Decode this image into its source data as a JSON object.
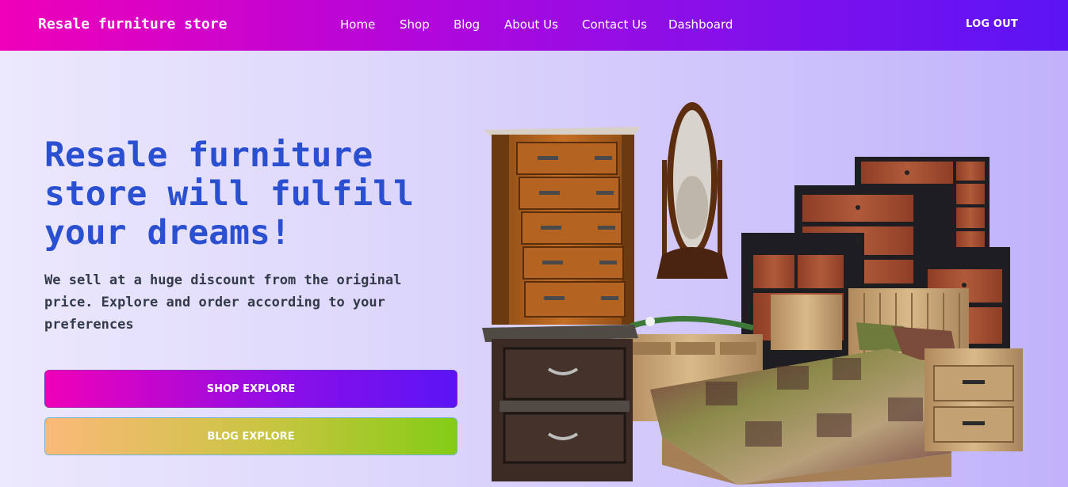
{
  "navbar": {
    "brand": "Resale furniture store",
    "links": [
      "Home",
      "Shop",
      "Blog",
      "About Us",
      "Contact Us",
      "Dashboard"
    ],
    "logout": "LOG OUT"
  },
  "hero": {
    "title_lines": [
      "Resale furniture",
      "store will fulfill",
      "your dreams!"
    ],
    "subtitle_lines": [
      "We sell at a huge discount from the original",
      "price. Explore and order according to your",
      "preferences"
    ],
    "shop_button": "SHOP EXPLORE",
    "blog_button": "BLOG EXPLORE"
  },
  "colors": {
    "primary_pink": "#f000b8",
    "primary_violet": "#5b14f5",
    "title_blue": "#2a4fd0",
    "secondary_orange": "#fbb97a",
    "secondary_green": "#84cc16"
  },
  "image": {
    "name": "furniture-collection-image"
  }
}
